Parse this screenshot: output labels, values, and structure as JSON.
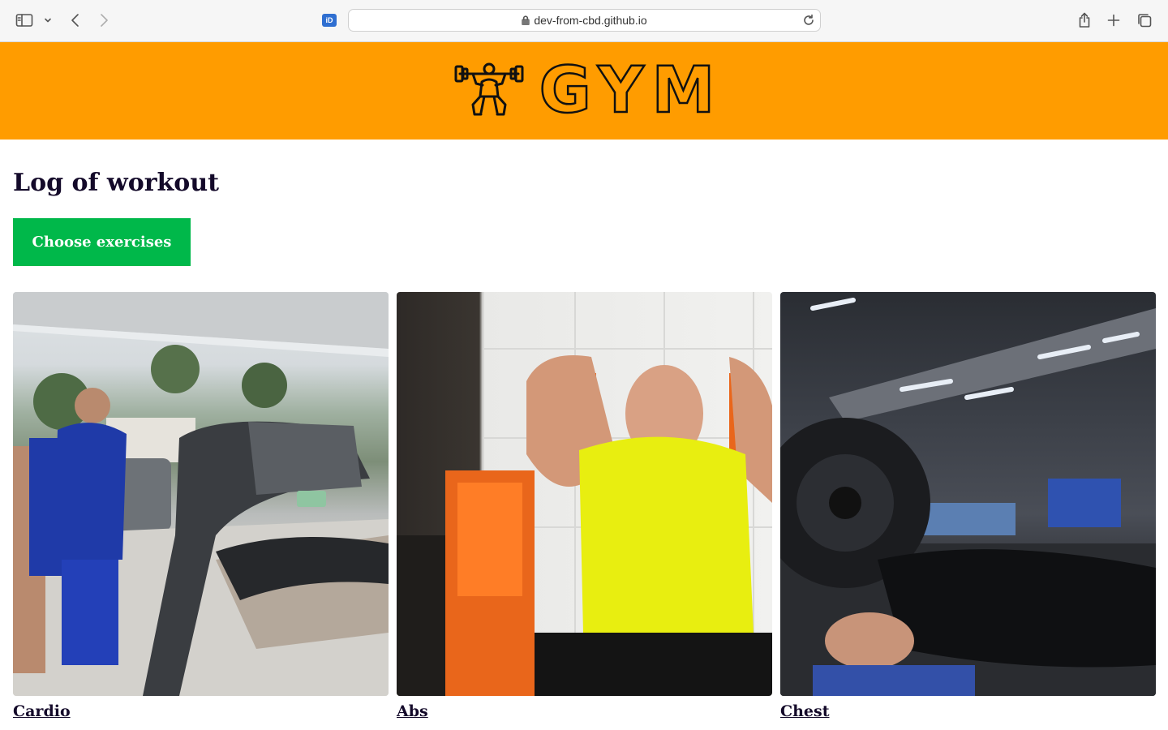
{
  "browser": {
    "url": "dev-from-cbd.github.io",
    "site_icon_text": "iD"
  },
  "header": {
    "logo_text": "GYM",
    "brand_color": "#ff9c00"
  },
  "main": {
    "title": "Log of workout",
    "choose_button_label": "Choose exercises",
    "button_color": "#00b84a",
    "cards": [
      {
        "label": "Cardio",
        "image": "man standing next to treadmill outdoors"
      },
      {
        "label": "Abs",
        "image": "man on orange ab crunch machine"
      },
      {
        "label": "Chest",
        "image": "man bench pressing in gym"
      }
    ]
  }
}
